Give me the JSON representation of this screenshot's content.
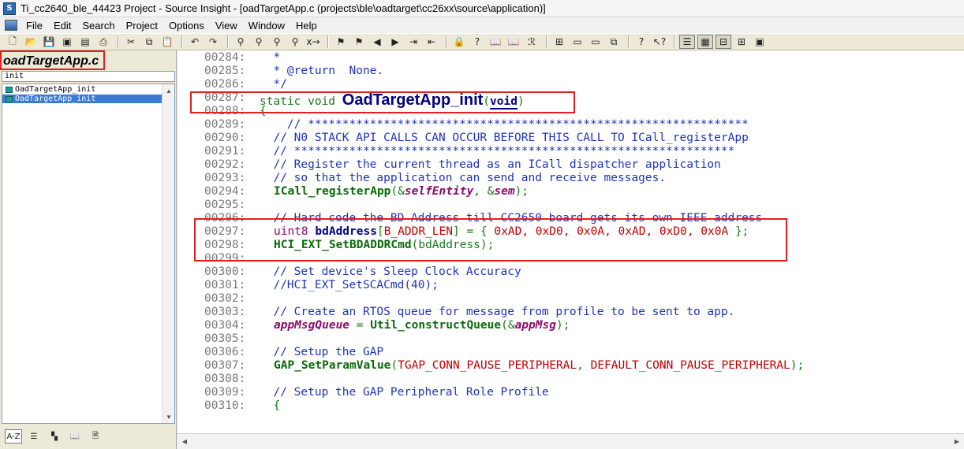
{
  "window": {
    "title": "Ti_cc2640_ble_44423 Project - Source Insight - [oadTargetApp.c (projects\\ble\\oadtarget\\cc26xx\\source\\application)]"
  },
  "menu": [
    "File",
    "Edit",
    "Search",
    "Project",
    "Options",
    "View",
    "Window",
    "Help"
  ],
  "left_panel": {
    "file_title": "oadTargetApp.c",
    "filter_value": "init",
    "symbols": [
      {
        "label": "OadTargetApp_init",
        "selected": false
      },
      {
        "label": "OadTargetApp_init",
        "selected": true
      }
    ]
  },
  "code_lines": [
    {
      "num": "00284:",
      "text": "  *"
    },
    {
      "num": "00285:",
      "text": "  * @return  None."
    },
    {
      "num": "00286:",
      "text": "  */"
    },
    {
      "num": "00287:",
      "text": ""
    },
    {
      "num": "00288:",
      "text": "{"
    },
    {
      "num": "00289:",
      "text": "    // ****************************************************************"
    },
    {
      "num": "00290:",
      "text": "  // N0 STACK API CALLS CAN OCCUR BEFORE THIS CALL TO ICall_registerApp"
    },
    {
      "num": "00291:",
      "text": "  // ****************************************************************"
    },
    {
      "num": "00292:",
      "text": "  // Register the current thread as an ICall dispatcher application"
    },
    {
      "num": "00293:",
      "text": "  // so that the application can send and receive messages."
    },
    {
      "num": "00294:",
      "text": ""
    },
    {
      "num": "00295:",
      "text": ""
    },
    {
      "num": "00296:",
      "text": "  // Hard code the BD Address till CC2650 board gets its own IEEE address"
    },
    {
      "num": "00297:",
      "text": ""
    },
    {
      "num": "00298:",
      "text": ""
    },
    {
      "num": "00299:",
      "text": ""
    },
    {
      "num": "00300:",
      "text": "  // Set device's Sleep Clock Accuracy"
    },
    {
      "num": "00301:",
      "text": "  //HCI_EXT_SetSCACmd(40);"
    },
    {
      "num": "00302:",
      "text": ""
    },
    {
      "num": "00303:",
      "text": "  // Create an RTOS queue for message from profile to be sent to app."
    },
    {
      "num": "00304:",
      "text": ""
    },
    {
      "num": "00305:",
      "text": ""
    },
    {
      "num": "00306:",
      "text": "  // Setup the GAP"
    },
    {
      "num": "00307:",
      "text": ""
    },
    {
      "num": "00308:",
      "text": ""
    },
    {
      "num": "00309:",
      "text": "  // Setup the GAP Peripheral Role Profile"
    },
    {
      "num": "00310:",
      "text": "  {"
    }
  ],
  "code_tokens": {
    "l287_static": "static void ",
    "l287_func": "OadTargetApp_init",
    "l287_open": "(",
    "l287_void": "void",
    "l287_close": ")",
    "l294_func": "ICall_registerApp",
    "l294_a": "(&",
    "l294_self": "selfEntity",
    "l294_b": ", &",
    "l294_sem": "sem",
    "l294_c": ");",
    "l297_type": "uint8 ",
    "l297_var": "bdAddress",
    "l297_b1": "[",
    "l297_len": "B_ADDR_LEN",
    "l297_rest": "] = { ",
    "l297_vals": "0xAD, 0xD0, 0x0A, 0xAD, 0xD0, 0x0A",
    "l297_end": " };",
    "l298_func": "HCI_EXT_SetBDADDRCmd",
    "l298_args": "(bdAddress);",
    "l304_var": "appMsgQueue",
    "l304_eq": " = ",
    "l304_func": "Util_constructQueue",
    "l304_a": "(&",
    "l304_msg": "appMsg",
    "l304_c": ");",
    "l307_func": "GAP_SetParamValue",
    "l307_a": "(",
    "l307_p1": "TGAP_CONN_PAUSE_PERIPHERAL",
    "l307_b": ", ",
    "l307_p2": "DEFAULT_CONN_PAUSE_PERIPHERAL",
    "l307_c": ");"
  },
  "colors": {
    "comment": "#1e34b8",
    "keyword": "#1a7a1a",
    "highlight_box": "#e02020",
    "selection": "#3a7bd5"
  }
}
